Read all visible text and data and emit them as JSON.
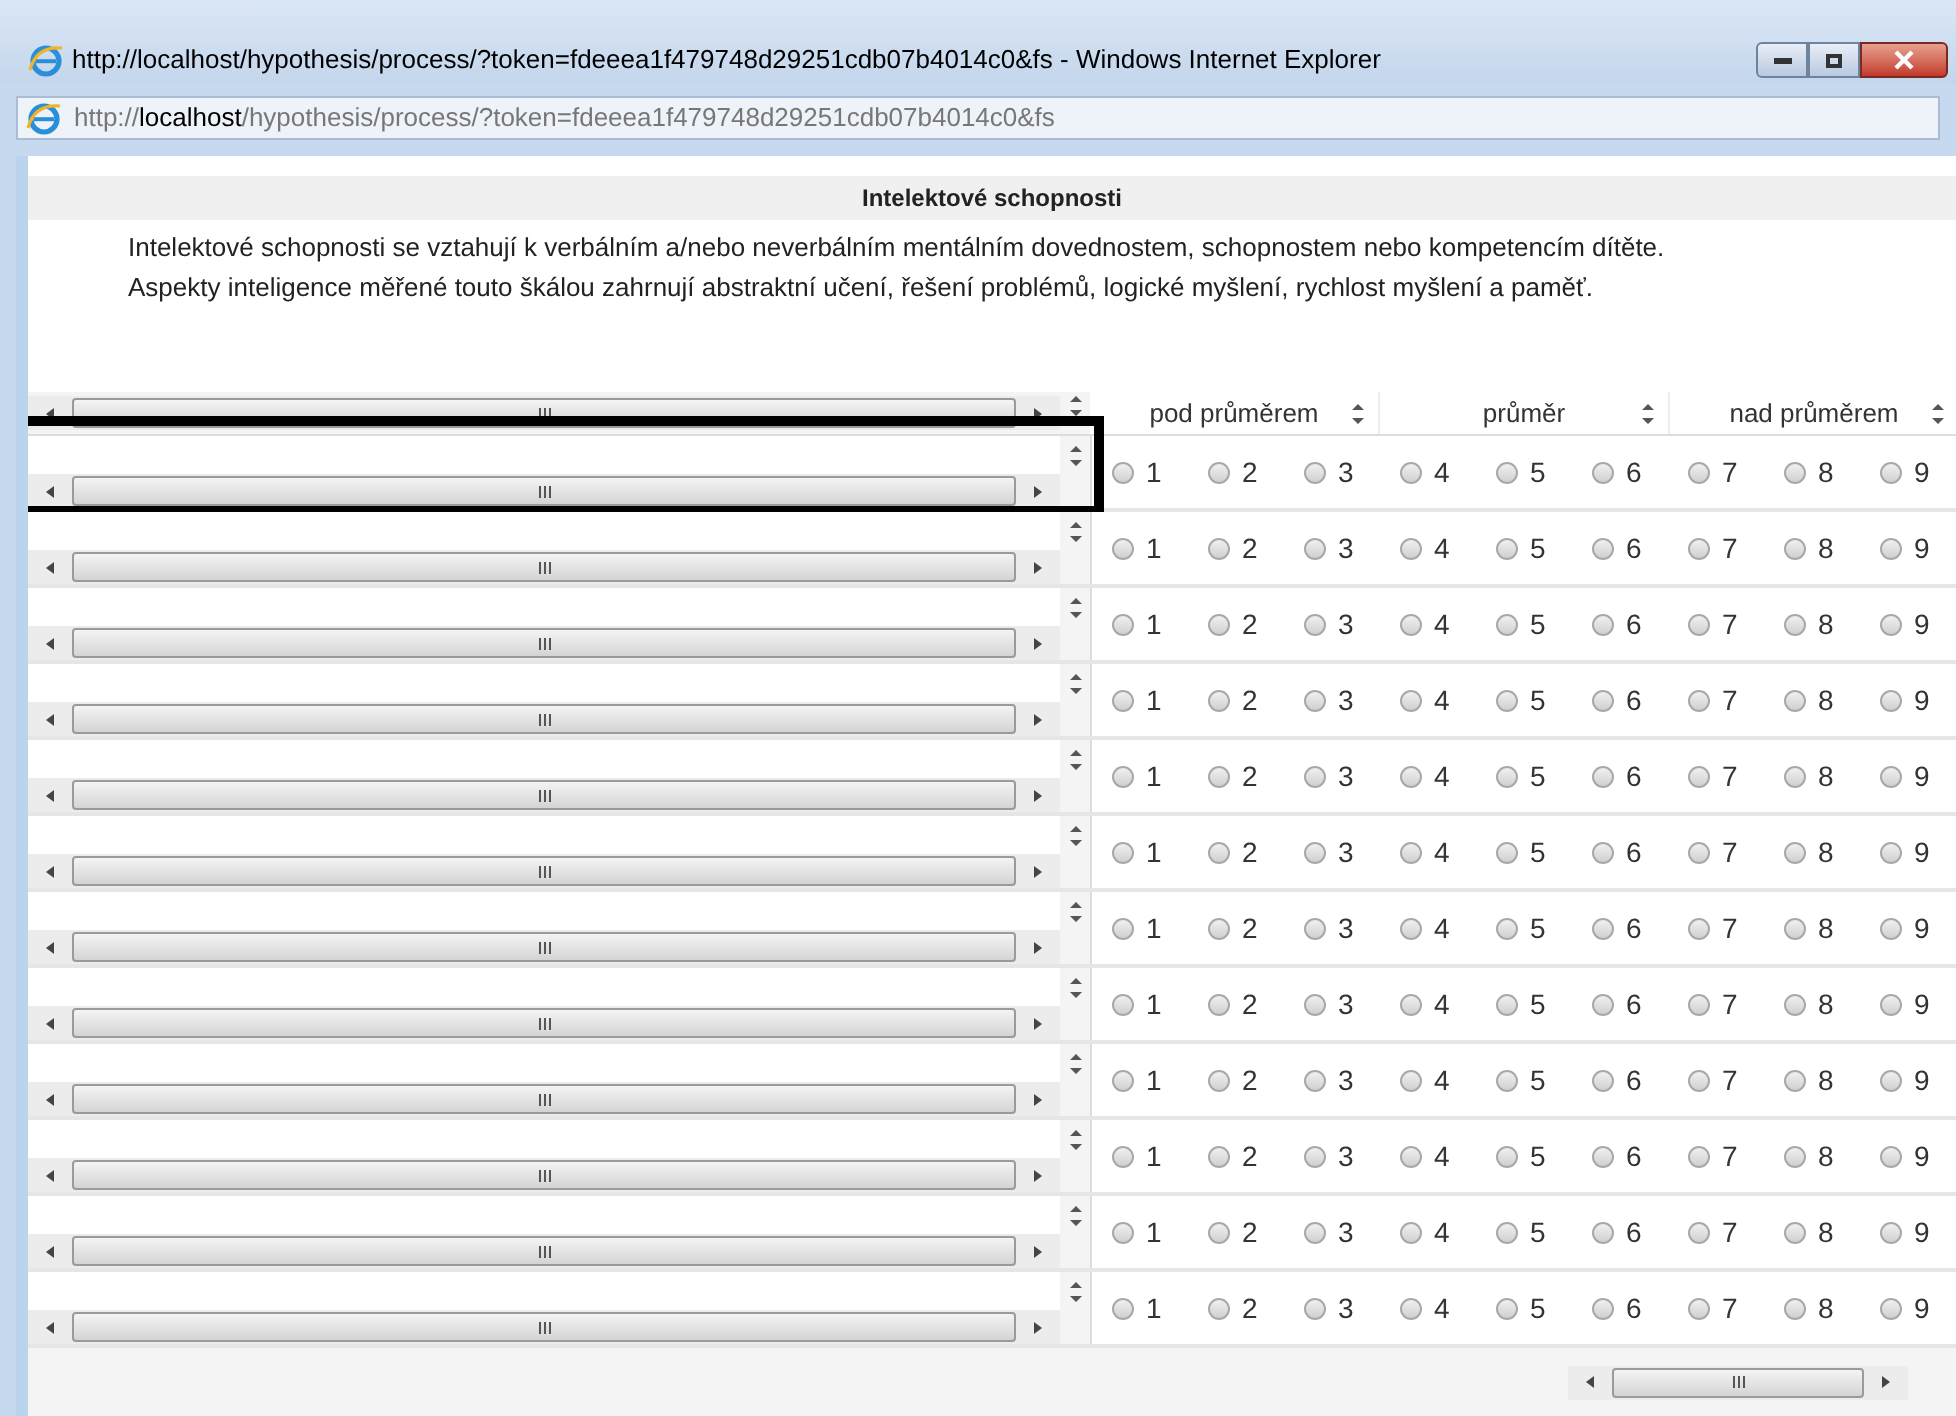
{
  "window": {
    "title": "http://localhost/hypothesis/process/?token=fdeeea1f479748d29251cdb07b4014c0&fs - Windows Internet Explorer"
  },
  "address_bar": {
    "scheme": "http://",
    "host": "localhost",
    "path": "/hypothesis/process/?token=fdeeea1f479748d29251cdb07b4014c0&fs"
  },
  "section": {
    "heading": "Intelektové schopnosti",
    "description": [
      "Intelektové schopnosti se vztahují k verbálním a/nebo neverbálním mentálním dovednostem, schopnostem nebo kompetencím dítěte.",
      "Aspekty inteligence měřené touto škálou zahrnují abstraktní učení, řešení problémů, logické myšlení, rychlost myšlení a paměť."
    ]
  },
  "column_groups": [
    "pod průměrem",
    "průměr",
    "nad průměrem"
  ],
  "rows": [
    {
      "highlighted": true,
      "options": [
        {
          "label": "1",
          "selected": false
        },
        {
          "label": "2",
          "selected": false
        },
        {
          "label": "3",
          "selected": false
        },
        {
          "label": "4",
          "selected": false
        },
        {
          "label": "5",
          "selected": false
        },
        {
          "label": "6",
          "selected": false
        },
        {
          "label": "7",
          "selected": false
        },
        {
          "label": "8",
          "selected": false
        },
        {
          "label": "9",
          "selected": false
        }
      ]
    },
    {
      "highlighted": false,
      "options": [
        {
          "label": "1",
          "selected": false
        },
        {
          "label": "2",
          "selected": false
        },
        {
          "label": "3",
          "selected": false
        },
        {
          "label": "4",
          "selected": false
        },
        {
          "label": "5",
          "selected": false
        },
        {
          "label": "6",
          "selected": false
        },
        {
          "label": "7",
          "selected": false
        },
        {
          "label": "8",
          "selected": false
        },
        {
          "label": "9",
          "selected": false
        }
      ]
    },
    {
      "highlighted": false,
      "options": [
        {
          "label": "1",
          "selected": false
        },
        {
          "label": "2",
          "selected": false
        },
        {
          "label": "3",
          "selected": false
        },
        {
          "label": "4",
          "selected": false
        },
        {
          "label": "5",
          "selected": false
        },
        {
          "label": "6",
          "selected": false
        },
        {
          "label": "7",
          "selected": false
        },
        {
          "label": "8",
          "selected": false
        },
        {
          "label": "9",
          "selected": false
        }
      ]
    },
    {
      "highlighted": false,
      "options": [
        {
          "label": "1",
          "selected": false
        },
        {
          "label": "2",
          "selected": false
        },
        {
          "label": "3",
          "selected": false
        },
        {
          "label": "4",
          "selected": false
        },
        {
          "label": "5",
          "selected": false
        },
        {
          "label": "6",
          "selected": false
        },
        {
          "label": "7",
          "selected": false
        },
        {
          "label": "8",
          "selected": false
        },
        {
          "label": "9",
          "selected": false
        }
      ]
    },
    {
      "highlighted": false,
      "options": [
        {
          "label": "1",
          "selected": false
        },
        {
          "label": "2",
          "selected": false
        },
        {
          "label": "3",
          "selected": false
        },
        {
          "label": "4",
          "selected": false
        },
        {
          "label": "5",
          "selected": false
        },
        {
          "label": "6",
          "selected": false
        },
        {
          "label": "7",
          "selected": false
        },
        {
          "label": "8",
          "selected": false
        },
        {
          "label": "9",
          "selected": false
        }
      ]
    },
    {
      "highlighted": false,
      "options": [
        {
          "label": "1",
          "selected": false
        },
        {
          "label": "2",
          "selected": false
        },
        {
          "label": "3",
          "selected": false
        },
        {
          "label": "4",
          "selected": false
        },
        {
          "label": "5",
          "selected": false
        },
        {
          "label": "6",
          "selected": false
        },
        {
          "label": "7",
          "selected": false
        },
        {
          "label": "8",
          "selected": false
        },
        {
          "label": "9",
          "selected": false
        }
      ]
    },
    {
      "highlighted": false,
      "options": [
        {
          "label": "1",
          "selected": false
        },
        {
          "label": "2",
          "selected": false
        },
        {
          "label": "3",
          "selected": false
        },
        {
          "label": "4",
          "selected": false
        },
        {
          "label": "5",
          "selected": false
        },
        {
          "label": "6",
          "selected": false
        },
        {
          "label": "7",
          "selected": false
        },
        {
          "label": "8",
          "selected": false
        },
        {
          "label": "9",
          "selected": false
        }
      ]
    },
    {
      "highlighted": false,
      "options": [
        {
          "label": "1",
          "selected": false
        },
        {
          "label": "2",
          "selected": false
        },
        {
          "label": "3",
          "selected": false
        },
        {
          "label": "4",
          "selected": false
        },
        {
          "label": "5",
          "selected": false
        },
        {
          "label": "6",
          "selected": false
        },
        {
          "label": "7",
          "selected": false
        },
        {
          "label": "8",
          "selected": false
        },
        {
          "label": "9",
          "selected": false
        }
      ]
    },
    {
      "highlighted": false,
      "options": [
        {
          "label": "1",
          "selected": false
        },
        {
          "label": "2",
          "selected": false
        },
        {
          "label": "3",
          "selected": false
        },
        {
          "label": "4",
          "selected": false
        },
        {
          "label": "5",
          "selected": false
        },
        {
          "label": "6",
          "selected": false
        },
        {
          "label": "7",
          "selected": false
        },
        {
          "label": "8",
          "selected": false
        },
        {
          "label": "9",
          "selected": false
        }
      ]
    },
    {
      "highlighted": false,
      "options": [
        {
          "label": "1",
          "selected": false
        },
        {
          "label": "2",
          "selected": false
        },
        {
          "label": "3",
          "selected": false
        },
        {
          "label": "4",
          "selected": false
        },
        {
          "label": "5",
          "selected": false
        },
        {
          "label": "6",
          "selected": false
        },
        {
          "label": "7",
          "selected": false
        },
        {
          "label": "8",
          "selected": false
        },
        {
          "label": "9",
          "selected": false
        }
      ]
    },
    {
      "highlighted": false,
      "options": [
        {
          "label": "1",
          "selected": false
        },
        {
          "label": "2",
          "selected": false
        },
        {
          "label": "3",
          "selected": false
        },
        {
          "label": "4",
          "selected": false
        },
        {
          "label": "5",
          "selected": false
        },
        {
          "label": "6",
          "selected": false
        },
        {
          "label": "7",
          "selected": false
        },
        {
          "label": "8",
          "selected": false
        },
        {
          "label": "9",
          "selected": false
        }
      ]
    },
    {
      "highlighted": false,
      "options": [
        {
          "label": "1",
          "selected": false
        },
        {
          "label": "2",
          "selected": false
        },
        {
          "label": "3",
          "selected": false
        },
        {
          "label": "4",
          "selected": false
        },
        {
          "label": "5",
          "selected": false
        },
        {
          "label": "6",
          "selected": false
        },
        {
          "label": "7",
          "selected": false
        },
        {
          "label": "8",
          "selected": false
        },
        {
          "label": "9",
          "selected": false
        }
      ]
    }
  ]
}
